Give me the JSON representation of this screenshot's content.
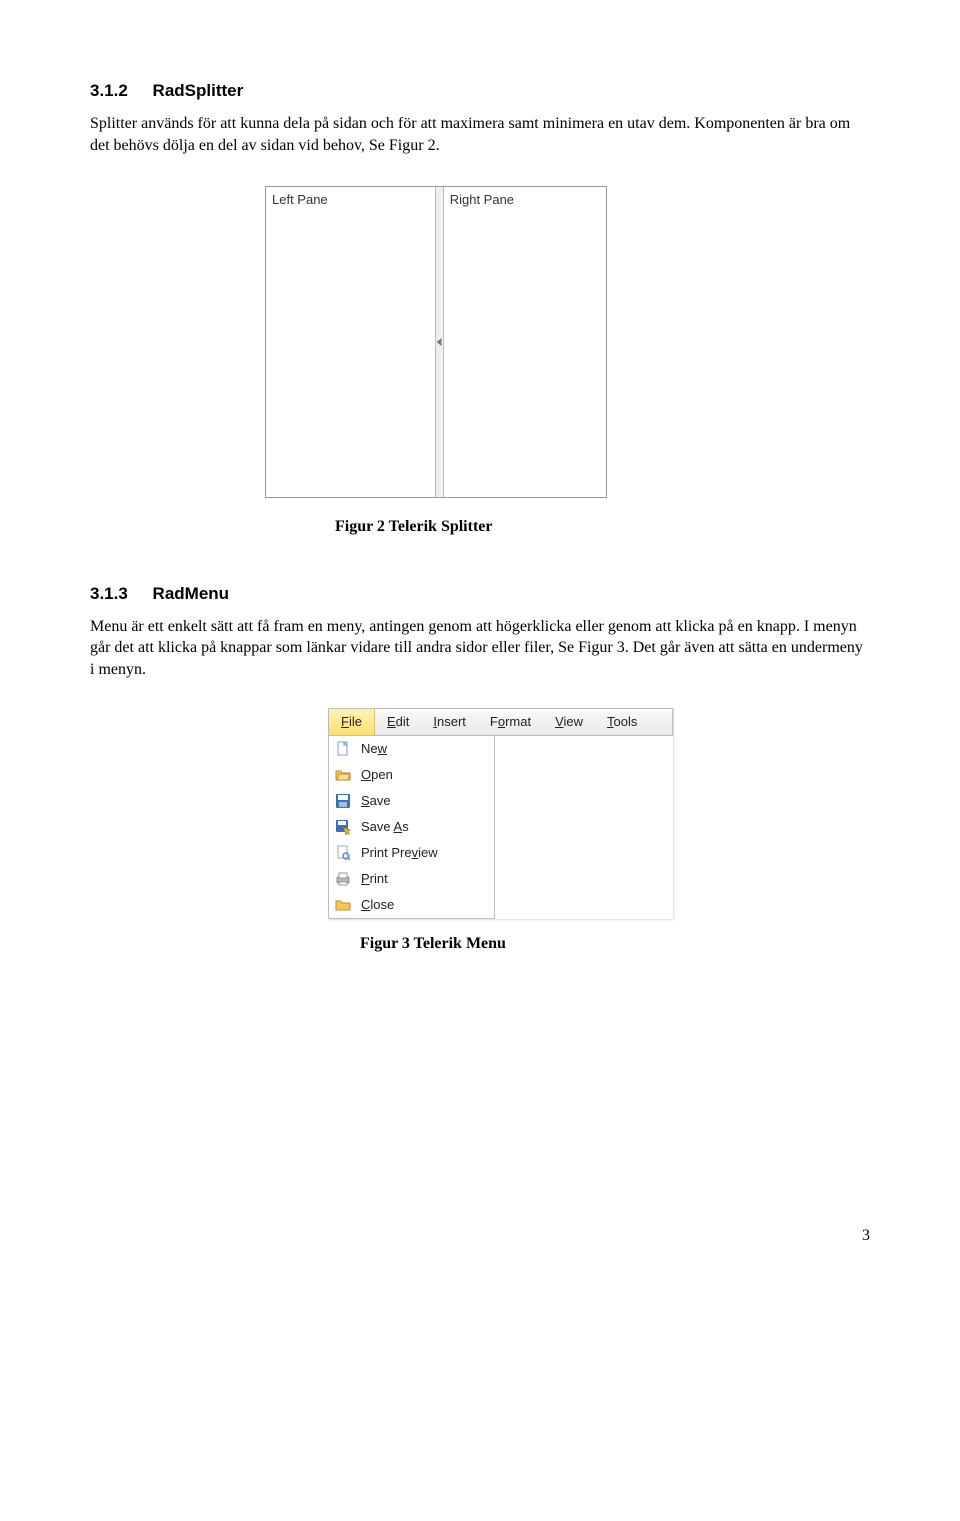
{
  "sections": {
    "splitter": {
      "heading_num": "3.1.2",
      "heading_title": "RadSplitter",
      "body": "Splitter används för att kunna dela på sidan och för att maximera samt minimera en utav dem. Komponenten är bra om det behövs dölja en del av sidan vid behov, Se Figur 2.",
      "left_label": "Left Pane",
      "right_label": "Right Pane",
      "caption": "Figur 2 Telerik Splitter"
    },
    "menu": {
      "heading_num": "3.1.3",
      "heading_title": "RadMenu",
      "body": "Menu är ett enkelt sätt att få fram en meny, antingen genom att högerklicka eller genom att klicka på en knapp. I menyn går det att klicka på knappar som länkar vidare till andra sidor eller filer, Se Figur 3. Det går även att sätta en undermeny i menyn.",
      "caption": "Figur 3 Telerik Menu",
      "bar": {
        "file": "File",
        "edit": "Edit",
        "insert": "Insert",
        "format": "Format",
        "view": "View",
        "tools": "Tools"
      },
      "items": {
        "new": "New",
        "open": "Open",
        "save": "Save",
        "saveas": "Save As",
        "printpreview": "Print Preview",
        "print": "Print",
        "close": "Close"
      }
    }
  },
  "page_number": "3"
}
